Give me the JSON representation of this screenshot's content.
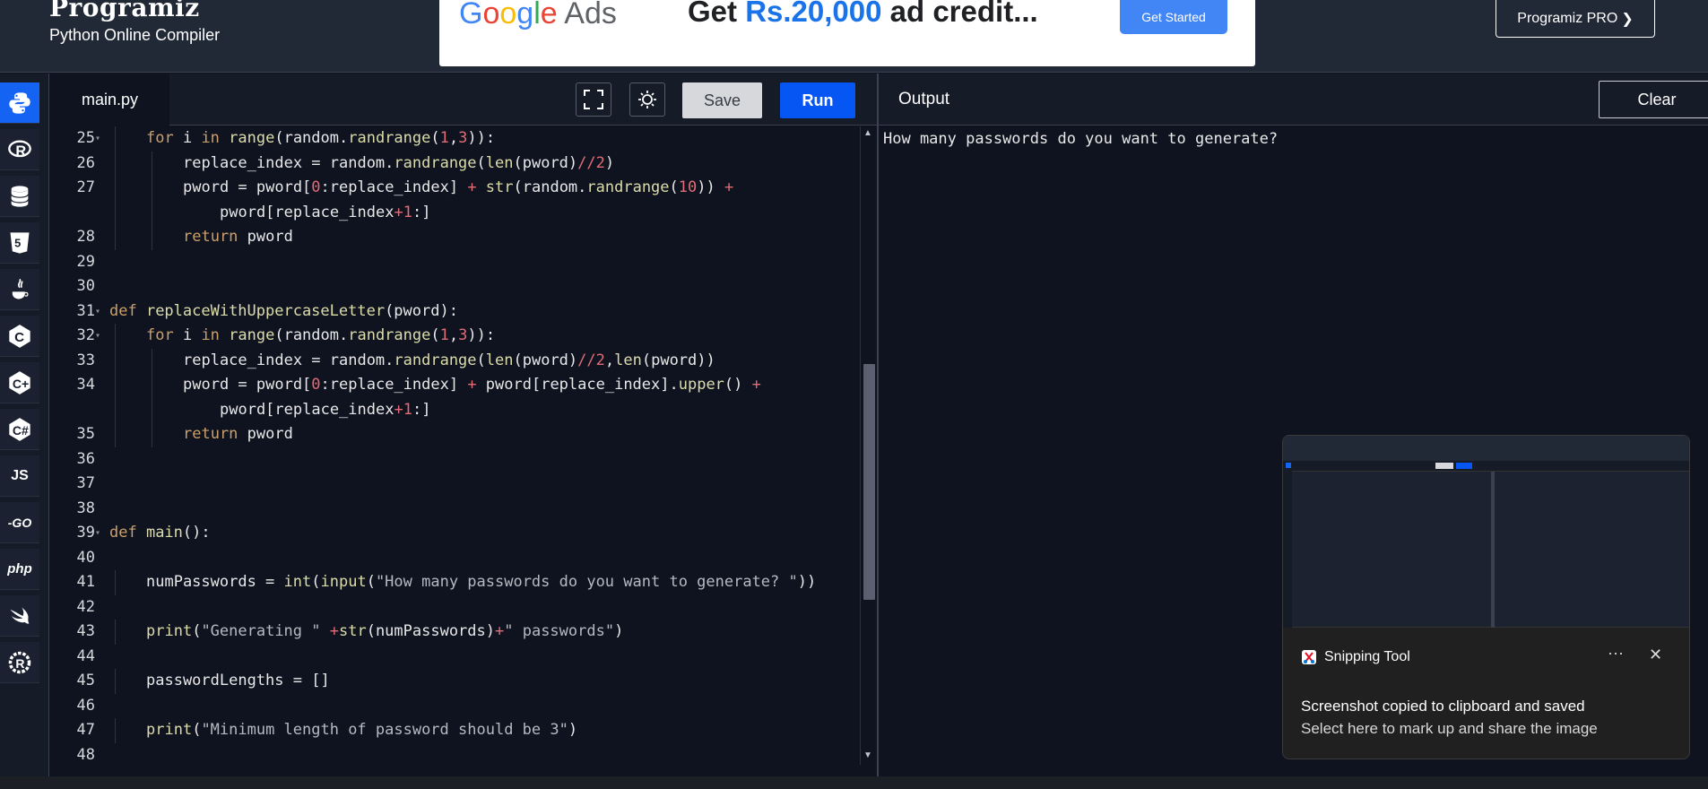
{
  "header": {
    "brand": "Programiz",
    "subtitle": "Python Online Compiler",
    "pro_button": "Programiz PRO",
    "ad": {
      "google_ads": "Google Ads",
      "headline_pre": "Get ",
      "headline_amount": "Rs.20,000",
      "headline_post": " ad credit...",
      "cta": "Get Started"
    }
  },
  "sidebar": {
    "items": [
      {
        "name": "python",
        "icon": "python-icon",
        "active": true
      },
      {
        "name": "r",
        "icon": "r-icon"
      },
      {
        "name": "sql",
        "icon": "database-icon"
      },
      {
        "name": "html",
        "icon": "html5-icon"
      },
      {
        "name": "java",
        "icon": "java-icon"
      },
      {
        "name": "c",
        "icon": "c-icon",
        "label": "C"
      },
      {
        "name": "cpp",
        "icon": "cpp-icon",
        "label": "C+"
      },
      {
        "name": "csharp",
        "icon": "csharp-icon",
        "label": "C#"
      },
      {
        "name": "js",
        "icon": "js-icon",
        "label": "JS"
      },
      {
        "name": "go",
        "icon": "go-icon",
        "label": "-GO"
      },
      {
        "name": "php",
        "icon": "php-icon",
        "label": "php"
      },
      {
        "name": "swift",
        "icon": "swift-icon"
      },
      {
        "name": "rust",
        "icon": "rust-icon"
      }
    ]
  },
  "editor": {
    "tab": "main.py",
    "save_label": "Save",
    "run_label": "Run",
    "lines": [
      {
        "n": "25",
        "fold": true,
        "indent": 1,
        "tokens": [
          [
            "kw",
            "for "
          ],
          [
            "",
            "i "
          ],
          [
            "kw",
            "in "
          ],
          [
            "fn",
            "range"
          ],
          [
            "",
            "(random."
          ],
          [
            "fn",
            "randrange"
          ],
          [
            "",
            "("
          ],
          [
            "num",
            "1"
          ],
          [
            "",
            ","
          ],
          [
            "num",
            "3"
          ],
          [
            "",
            "))"
          ],
          [
            "",
            ":"
          ]
        ]
      },
      {
        "n": "26",
        "indent": 2,
        "tokens": [
          [
            "",
            "replace_index = random."
          ],
          [
            "fn",
            "randrange"
          ],
          [
            "",
            "("
          ],
          [
            "fn",
            "len"
          ],
          [
            "",
            "(pword)"
          ],
          [
            "op",
            "//"
          ],
          [
            "num",
            "2"
          ],
          [
            "",
            ")"
          ]
        ]
      },
      {
        "n": "27",
        "indent": 2,
        "tokens": [
          [
            "",
            "pword = pword["
          ],
          [
            "num",
            "0"
          ],
          [
            "",
            ":replace_index] "
          ],
          [
            "op",
            "+ "
          ],
          [
            "fn",
            "str"
          ],
          [
            "",
            "(random."
          ],
          [
            "fn",
            "randrange"
          ],
          [
            "",
            "("
          ],
          [
            "num",
            "10"
          ],
          [
            "",
            "))"
          ],
          [
            "op",
            " +"
          ]
        ]
      },
      {
        "n": "",
        "indent": 3,
        "tokens": [
          [
            "",
            "pword[replace_index"
          ],
          [
            "op",
            "+"
          ],
          [
            "num",
            "1"
          ],
          [
            "",
            ":]"
          ]
        ]
      },
      {
        "n": "28",
        "indent": 2,
        "tokens": [
          [
            "kw",
            "return "
          ],
          [
            "",
            "pword"
          ]
        ]
      },
      {
        "n": "29",
        "indent": 0,
        "tokens": []
      },
      {
        "n": "30",
        "indent": 0,
        "tokens": []
      },
      {
        "n": "31",
        "fold": true,
        "indent": 0,
        "tokens": [
          [
            "kw",
            "def "
          ],
          [
            "fn",
            "replaceWithUppercaseLetter"
          ],
          [
            "",
            "(pword):"
          ]
        ]
      },
      {
        "n": "32",
        "fold": true,
        "indent": 1,
        "tokens": [
          [
            "kw",
            "for "
          ],
          [
            "",
            "i "
          ],
          [
            "kw",
            "in "
          ],
          [
            "fn",
            "range"
          ],
          [
            "",
            "(random."
          ],
          [
            "fn",
            "randrange"
          ],
          [
            "",
            "("
          ],
          [
            "num",
            "1"
          ],
          [
            "",
            ","
          ],
          [
            "num",
            "3"
          ],
          [
            "",
            "))"
          ],
          [
            "",
            ":"
          ]
        ]
      },
      {
        "n": "33",
        "indent": 2,
        "tokens": [
          [
            "",
            "replace_index = random."
          ],
          [
            "fn",
            "randrange"
          ],
          [
            "",
            "("
          ],
          [
            "fn",
            "len"
          ],
          [
            "",
            "(pword)"
          ],
          [
            "op",
            "//"
          ],
          [
            "num",
            "2"
          ],
          [
            "",
            ","
          ],
          [
            "fn",
            "len"
          ],
          [
            "",
            "(pword))"
          ]
        ]
      },
      {
        "n": "34",
        "indent": 2,
        "tokens": [
          [
            "",
            "pword = pword["
          ],
          [
            "num",
            "0"
          ],
          [
            "",
            ":replace_index] "
          ],
          [
            "op",
            "+ "
          ],
          [
            "",
            "pword[replace_index]."
          ],
          [
            "fn",
            "upper"
          ],
          [
            "",
            "() "
          ],
          [
            "op",
            "+"
          ]
        ]
      },
      {
        "n": "",
        "indent": 3,
        "tokens": [
          [
            "",
            "pword[replace_index"
          ],
          [
            "op",
            "+"
          ],
          [
            "num",
            "1"
          ],
          [
            "",
            ":]"
          ]
        ]
      },
      {
        "n": "35",
        "indent": 2,
        "tokens": [
          [
            "kw",
            "return "
          ],
          [
            "",
            "pword"
          ]
        ]
      },
      {
        "n": "36",
        "indent": 0,
        "tokens": []
      },
      {
        "n": "37",
        "indent": 0,
        "tokens": []
      },
      {
        "n": "38",
        "indent": 0,
        "tokens": []
      },
      {
        "n": "39",
        "fold": true,
        "indent": 0,
        "tokens": [
          [
            "kw",
            "def "
          ],
          [
            "fn",
            "main"
          ],
          [
            "",
            "():"
          ]
        ]
      },
      {
        "n": "40",
        "indent": 0,
        "tokens": []
      },
      {
        "n": "41",
        "indent": 1,
        "tokens": [
          [
            "",
            "numPasswords = "
          ],
          [
            "fn",
            "int"
          ],
          [
            "",
            "("
          ],
          [
            "fn",
            "input"
          ],
          [
            "",
            "("
          ],
          [
            "str",
            "\"How many passwords do you want to generate? \""
          ],
          [
            "",
            "))"
          ]
        ]
      },
      {
        "n": "42",
        "indent": 0,
        "tokens": []
      },
      {
        "n": "43",
        "indent": 1,
        "tokens": [
          [
            "fn",
            "print"
          ],
          [
            "",
            "("
          ],
          [
            "str",
            "\"Generating \""
          ],
          [
            "op",
            " +"
          ],
          [
            "fn",
            "str"
          ],
          [
            "",
            "(numPasswords)"
          ],
          [
            "op",
            "+"
          ],
          [
            "str",
            "\" passwords\""
          ],
          [
            "",
            ")"
          ]
        ]
      },
      {
        "n": "44",
        "indent": 0,
        "tokens": []
      },
      {
        "n": "45",
        "indent": 1,
        "tokens": [
          [
            "",
            "passwordLengths = []"
          ]
        ]
      },
      {
        "n": "46",
        "indent": 0,
        "tokens": []
      },
      {
        "n": "47",
        "indent": 1,
        "tokens": [
          [
            "fn",
            "print"
          ],
          [
            "",
            "("
          ],
          [
            "str",
            "\"Minimum length of password should be 3\""
          ],
          [
            "",
            ")"
          ]
        ]
      },
      {
        "n": "48",
        "indent": 0,
        "tokens": []
      }
    ]
  },
  "output": {
    "title": "Output",
    "clear_label": "Clear",
    "text": "How many passwords do you want to generate?"
  },
  "toast": {
    "app_name": "Snipping Tool",
    "more": "···",
    "close": "✕",
    "message": "Screenshot copied to clipboard and saved",
    "sub": "Select here to mark up and share the image"
  },
  "colors": {
    "accent": "#0556f3",
    "background": "#0f1320",
    "header": "#212836",
    "keyword": "#c9a06a",
    "function": "#dcdcaa",
    "number": "#e06c75"
  }
}
